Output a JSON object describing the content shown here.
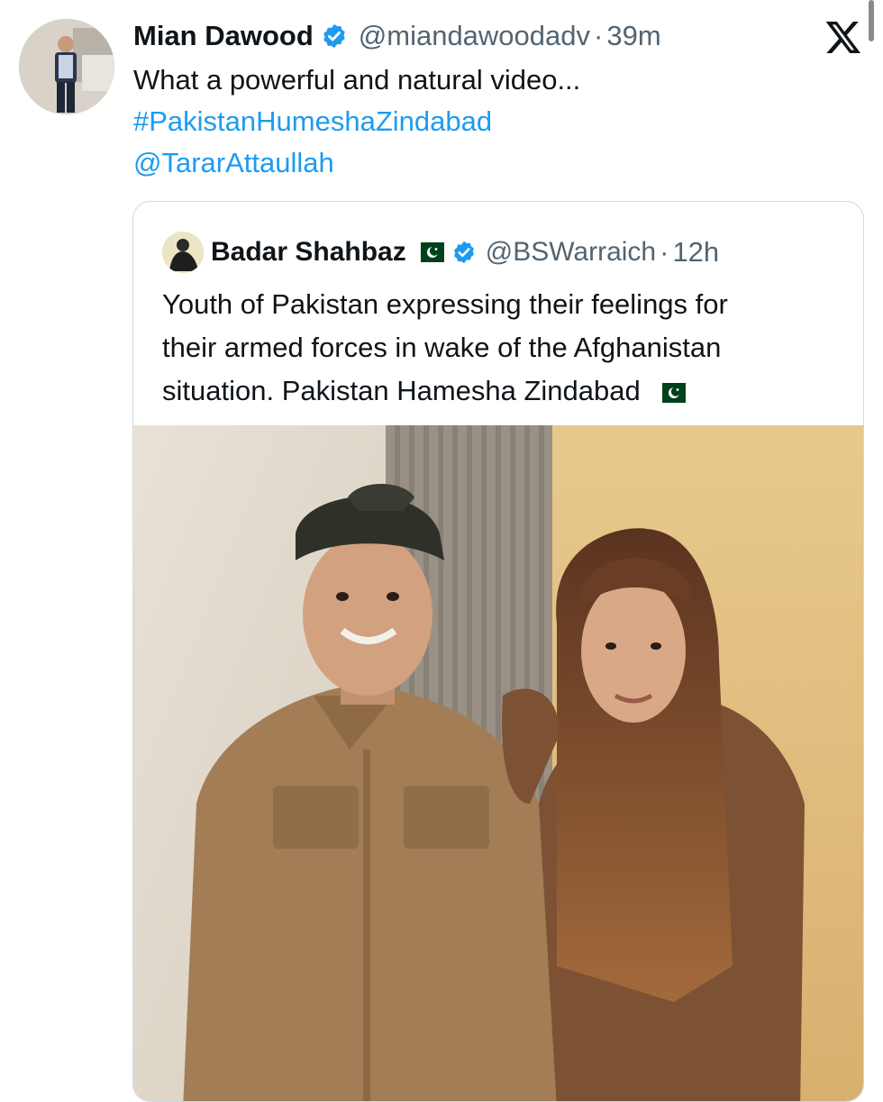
{
  "tweet": {
    "author_name": "Mian Dawood",
    "handle": "@miandawoodadv",
    "separator": "·",
    "time": "39m",
    "text_line1": "What a powerful and natural video...",
    "hashtag": "#PakistanHumeshaZindabad",
    "mention": "@TararAttaullah"
  },
  "quoted_tweet": {
    "author_name": "Badar Shahbaz",
    "handle": "@BSWarraich",
    "separator": "·",
    "time": "12h",
    "text_line1": "Youth of Pakistan expressing their feelings for",
    "text_line2": "their armed forces in wake of the Afghanistan",
    "text_line3": "situation. Pakistan Hamesha Zindabad"
  },
  "icons": {
    "verified": "verified-badge-icon",
    "flag": "pakistan-flag-icon",
    "brand": "x-logo-icon"
  },
  "colors": {
    "link": "#1d9bf0",
    "verified": "#1d9bf0",
    "secondary_text": "#536471",
    "border": "#cfd9de"
  }
}
